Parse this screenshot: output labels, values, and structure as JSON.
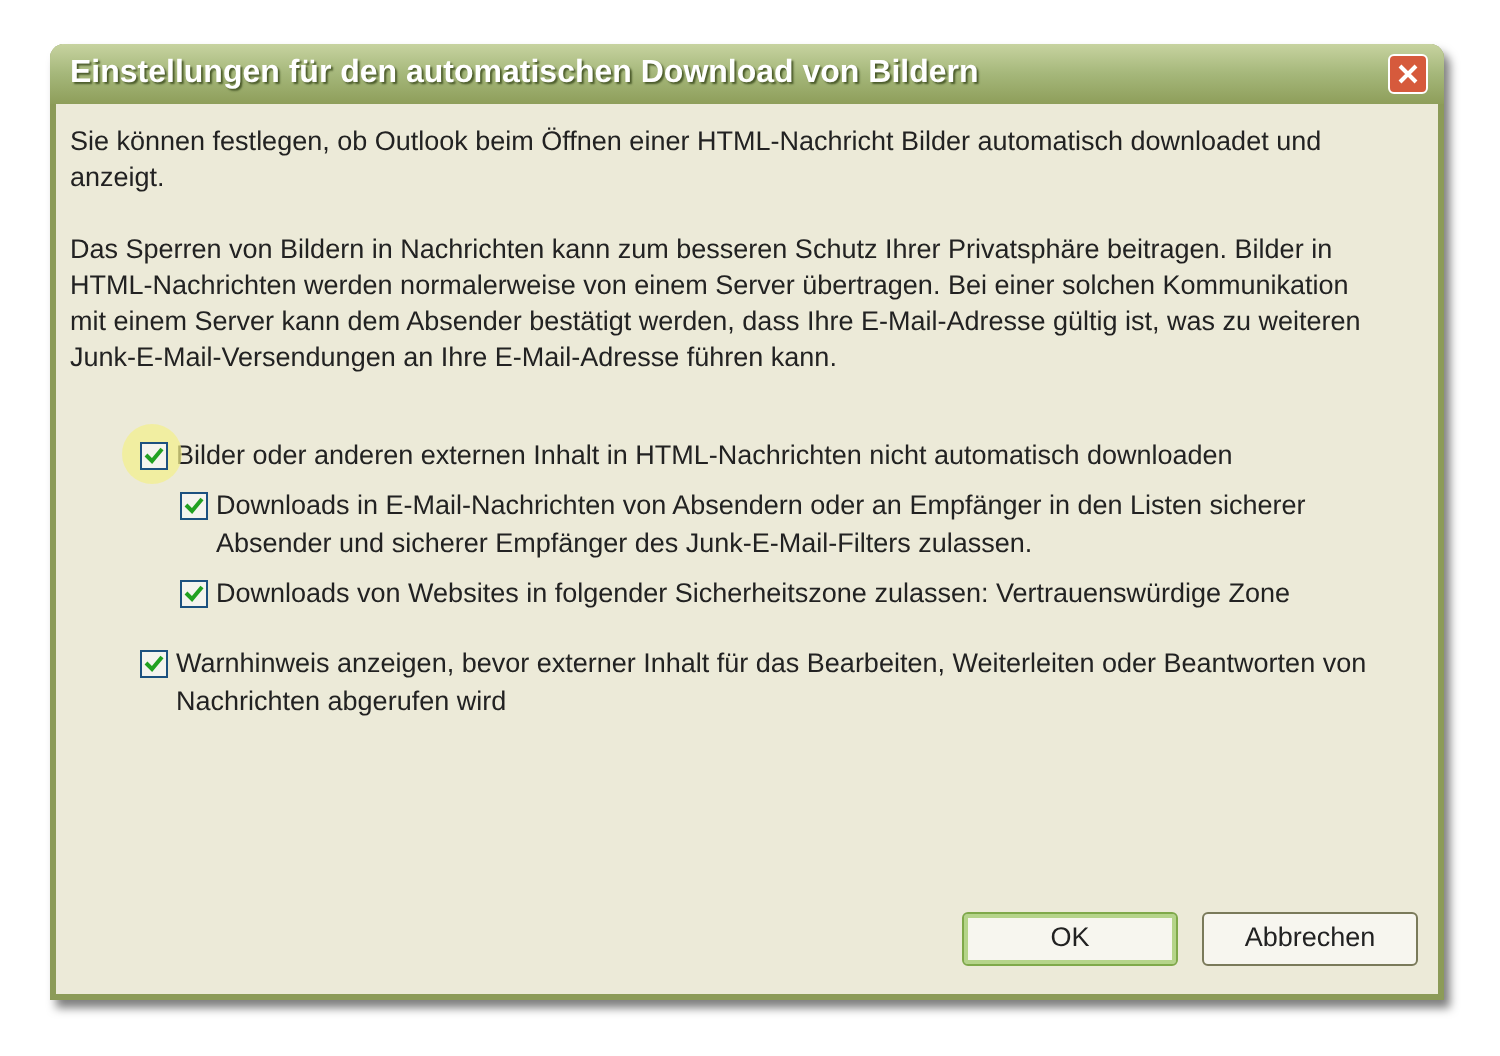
{
  "window": {
    "title": "Einstellungen für den automatischen Download von Bildern"
  },
  "paragraphs": [
    "Sie können festlegen, ob Outlook beim Öffnen einer HTML-Nachricht Bilder automatisch downloadet und anzeigt.",
    "Das Sperren von Bildern in Nachrichten kann zum besseren Schutz Ihrer Privatsphäre beitragen. Bilder in HTML-Nachrichten werden normalerweise von einem Server übertragen. Bei einer solchen Kommunikation mit einem Server kann dem Absender bestätigt werden, dass Ihre E-Mail-Adresse gültig ist, was zu weiteren Junk-E-Mail-Versendungen an Ihre E-Mail-Adresse führen kann."
  ],
  "options": [
    {
      "label": "Bilder oder anderen externen Inhalt in HTML-Nachrichten nicht automatisch downloaden",
      "checked": true,
      "highlighted": true,
      "children": [
        {
          "label": "Downloads in E-Mail-Nachrichten von Absendern oder an Empfänger in den Listen sicherer Absender und sicherer Empfänger des Junk-E-Mail-Filters zulassen.",
          "checked": true,
          "highlighted": false
        },
        {
          "label": "Downloads von Websites in folgender Sicherheitszone zulassen: Vertrauenswürdige Zone",
          "checked": true,
          "highlighted": false
        }
      ]
    },
    {
      "label": "Warnhinweis anzeigen, bevor externer Inhalt für das Bearbeiten, Weiterleiten oder Beantworten von Nachrichten abgerufen wird",
      "checked": true,
      "highlighted": false
    }
  ],
  "buttons": [
    {
      "label": "OK",
      "default": true
    },
    {
      "label": "Abbrechen",
      "default": false
    }
  ]
}
